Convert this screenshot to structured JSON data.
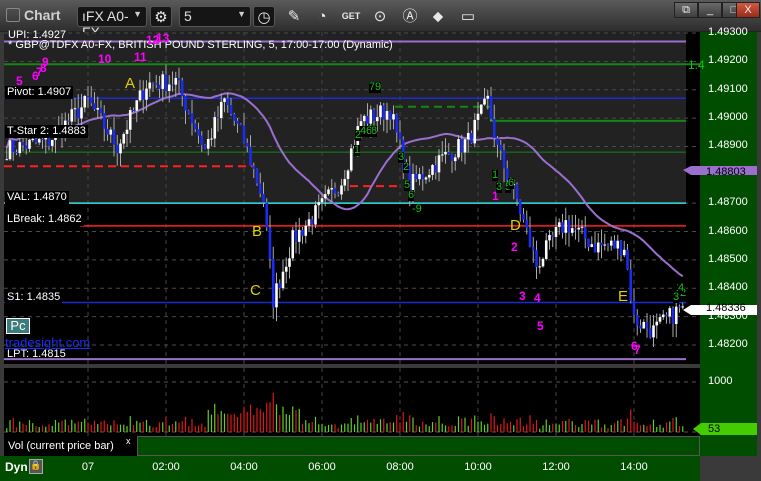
{
  "window": {
    "title": "Chart",
    "symbol": "GBP@TDFX A0-FX",
    "symbol_display": "ıFX A0-FX",
    "interval": "5",
    "buttons": [
      "restore",
      "minimize",
      "maximize",
      "close"
    ],
    "close_label": "X"
  },
  "toolbar_icons": [
    "settings-gear-icon",
    "clock-icon",
    "pencil-icon",
    "indicator-icon",
    "get-icon",
    "play-icon",
    "annotation-icon",
    "link-icon",
    "comment-icon"
  ],
  "chart": {
    "header": "* GBP@TDFX A0-FX, BRITISH POUND STERLING, 5, 17:00-17:00 (Dynamic)",
    "colors": {
      "up": "#ffffff",
      "down": "#1a2cf0",
      "ma": "#9b6fd0",
      "axis_bg": "#004d00",
      "vol_up": "#62d020",
      "vol_down": "#e01818"
    },
    "price_axis": [
      "1.49300",
      "1.49200",
      "1.49100",
      "1.49000",
      "1.48900",
      "1.48700",
      "1.48600",
      "1.48500",
      "1.48400",
      "1.48300",
      "1.48200"
    ],
    "ma_value": "1.48803",
    "last_price": "1.48336",
    "levels": [
      {
        "label": "UPI: 1.4927",
        "price": 1.4927,
        "color": "#9b6fd0"
      },
      {
        "label": "Pivot: 1.4907",
        "price": 1.4907,
        "color": "#1a2cd0"
      },
      {
        "label": "T-Star 2: 1.4883",
        "price": 1.4883,
        "color": "#ff2020"
      },
      {
        "label": "VAL: 1.4870",
        "price": 1.487,
        "color": "#30e0e0"
      },
      {
        "label": "LBreak: 1.4862",
        "price": 1.4862,
        "color": "#ff2020"
      },
      {
        "label": "S1: 1.4835",
        "price": 1.4835,
        "color": "#1a2cd0"
      },
      {
        "label": "LPT: 1.4815",
        "price": 1.4815,
        "color": "#9b6fd0"
      }
    ],
    "green_label": "1.4",
    "pc_button": "Pc",
    "watermark": "tradesight.com",
    "letters": [
      {
        "t": "A",
        "time": "01:15"
      },
      {
        "t": "B",
        "time": "04:15"
      },
      {
        "t": "C",
        "time": "04:15"
      },
      {
        "t": "D",
        "time": "11:00"
      },
      {
        "t": "E",
        "time": "13:45"
      }
    ],
    "counts_magenta": [
      "5",
      "6",
      "7",
      "8",
      "9",
      "10",
      "11",
      "12",
      "13",
      "1",
      "2",
      "3",
      "4",
      "5",
      "6",
      "7"
    ],
    "counts_green": [
      "7",
      "9",
      "2",
      "4",
      "6",
      "8",
      "1",
      "3",
      "2",
      "5",
      "6",
      "-9",
      "1",
      "3",
      "5",
      "6",
      "1",
      "2",
      "3",
      "4"
    ]
  },
  "chart_data": {
    "type": "candlestick",
    "interval_minutes": 5,
    "path": [
      [
        "21:55",
        1.4889
      ],
      [
        "23:00",
        1.4892
      ],
      [
        "00:00",
        1.4906
      ],
      [
        "00:45",
        1.489
      ],
      [
        "01:30",
        1.4912
      ],
      [
        "02:15",
        1.4913
      ],
      [
        "03:00",
        1.4889
      ],
      [
        "03:30",
        1.4906
      ],
      [
        "04:00",
        1.4892
      ],
      [
        "04:30",
        1.4871
      ],
      [
        "04:45",
        1.4836
      ],
      [
        "05:15",
        1.4857
      ],
      [
        "06:00",
        1.4869
      ],
      [
        "06:30",
        1.4878
      ],
      [
        "07:00",
        1.4899
      ],
      [
        "07:45",
        1.4903
      ],
      [
        "08:15",
        1.4876
      ],
      [
        "09:00",
        1.4885
      ],
      [
        "09:45",
        1.4892
      ],
      [
        "10:15",
        1.4906
      ],
      [
        "10:30",
        1.4889
      ],
      [
        "11:00",
        1.4871
      ],
      [
        "11:30",
        1.4848
      ],
      [
        "12:00",
        1.4859
      ],
      [
        "12:15",
        1.4863
      ],
      [
        "13:00",
        1.4855
      ],
      [
        "13:45",
        1.4855
      ],
      [
        "14:00",
        1.4829
      ],
      [
        "14:30",
        1.4825
      ],
      [
        "15:15",
        1.48336
      ]
    ],
    "ylim": [
      1.4815,
      1.4932
    ],
    "x_ticks": [
      "07",
      "02:00",
      "04:00",
      "06:00",
      "08:00",
      "10:00",
      "12:00",
      "14:00"
    ],
    "volume": {
      "axis_label": "1000",
      "current": "53",
      "title": "Vol (current price bar)"
    }
  },
  "footer": {
    "mode": "Dyn"
  }
}
